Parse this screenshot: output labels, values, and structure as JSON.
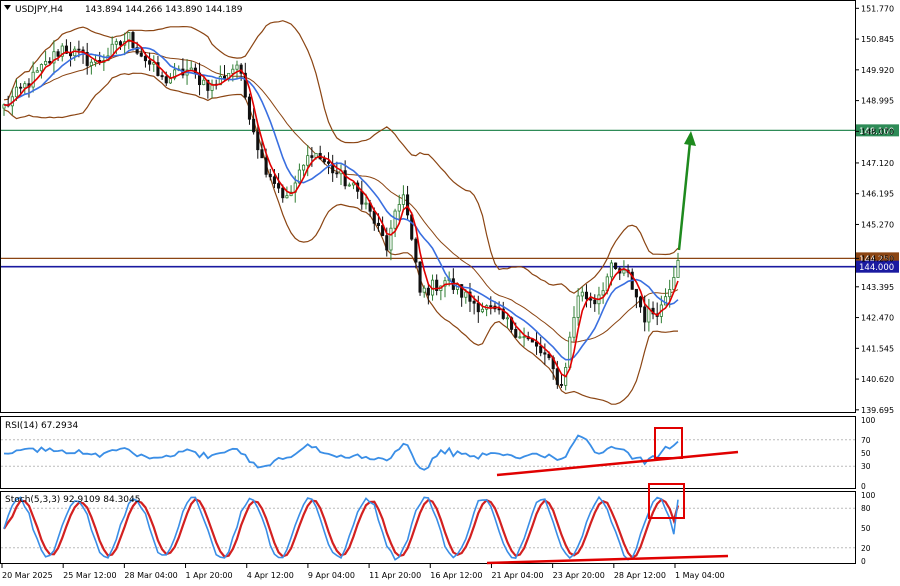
{
  "header": {
    "symbol_tf": "USDJPY,H4",
    "ohlc": "143.894 144.266 143.890 144.189"
  },
  "indicators": {
    "rsi_label": "RSI(14) 67.2934",
    "stoch_label": "Stoch(5,3,3) 92.9109 84.3045"
  },
  "colors": {
    "bull": "#2e7d32",
    "bear": "#111111",
    "bollinger": "#8b4513",
    "ma_fast": "#e00000",
    "ma_slow": "#3a6fe0",
    "level_green": "#2e8b57",
    "level_blue": "#1a1aa0",
    "level_brown": "#8b4513",
    "rsi_line": "#3a8ee6",
    "stoch_main": "#3a8ee6",
    "stoch_signal": "#d32020",
    "trend_red": "#e00000",
    "arrow": "#1e8a1e"
  },
  "chart_data": [
    {
      "type": "candlestick",
      "title": "USDJPY,H4",
      "ylim": [
        139.69,
        151.9
      ],
      "price_axis_ticks": [
        151.77,
        150.845,
        149.92,
        148.995,
        148.07,
        147.12,
        146.195,
        145.27,
        144.25,
        143.395,
        142.47,
        141.545,
        140.62,
        139.695
      ],
      "time_labels": [
        "20 Mar 2025",
        "25 Mar 12:00",
        "28 Mar 04:00",
        "1 Apr 20:00",
        "4 Apr 12:00",
        "9 Apr 04:00",
        "11 Apr 20:00",
        "16 Apr 12:00",
        "21 Apr 04:00",
        "23 Apr 20:00",
        "28 Apr 12:00",
        "1 May 04:00"
      ],
      "levels": [
        {
          "value": 148.1,
          "label": "148.100",
          "color": "green"
        },
        {
          "value": 144.25,
          "label": "144.250",
          "color": "brown"
        },
        {
          "value": 144.0,
          "label": "144.000",
          "color": "blue"
        }
      ],
      "path_keypoints": [
        [
          0,
          148.8
        ],
        [
          8,
          149.8
        ],
        [
          14,
          150.6
        ],
        [
          22,
          150.1
        ],
        [
          30,
          150.9
        ],
        [
          38,
          149.6
        ],
        [
          44,
          149.9
        ],
        [
          50,
          149.4
        ],
        [
          56,
          150.1
        ],
        [
          62,
          147.2
        ],
        [
          68,
          146.0
        ],
        [
          74,
          147.5
        ],
        [
          80,
          146.8
        ],
        [
          86,
          146.1
        ],
        [
          92,
          144.6
        ],
        [
          96,
          146.3
        ],
        [
          100,
          143.2
        ],
        [
          106,
          143.6
        ],
        [
          112,
          143.0
        ],
        [
          118,
          142.6
        ],
        [
          124,
          142.0
        ],
        [
          130,
          141.3
        ],
        [
          134,
          140.4
        ],
        [
          138,
          143.2
        ],
        [
          142,
          143.0
        ],
        [
          146,
          143.9
        ],
        [
          150,
          143.7
        ],
        [
          154,
          142.5
        ],
        [
          158,
          142.8
        ],
        [
          162,
          144.19
        ]
      ],
      "last_close": 144.189,
      "bars": 163
    },
    {
      "type": "line",
      "title": "RSI(14) 67.2934",
      "ylim": [
        0,
        100
      ],
      "y_ticks": [
        100,
        70,
        50,
        30,
        0
      ],
      "last": 67.2934
    },
    {
      "type": "line",
      "title": "Stoch(5,3,3) 92.9109 84.3045",
      "ylim": [
        0,
        100
      ],
      "y_ticks": [
        100,
        80,
        50,
        20,
        0
      ],
      "last_main": 92.9109,
      "last_signal": 84.3045
    }
  ]
}
